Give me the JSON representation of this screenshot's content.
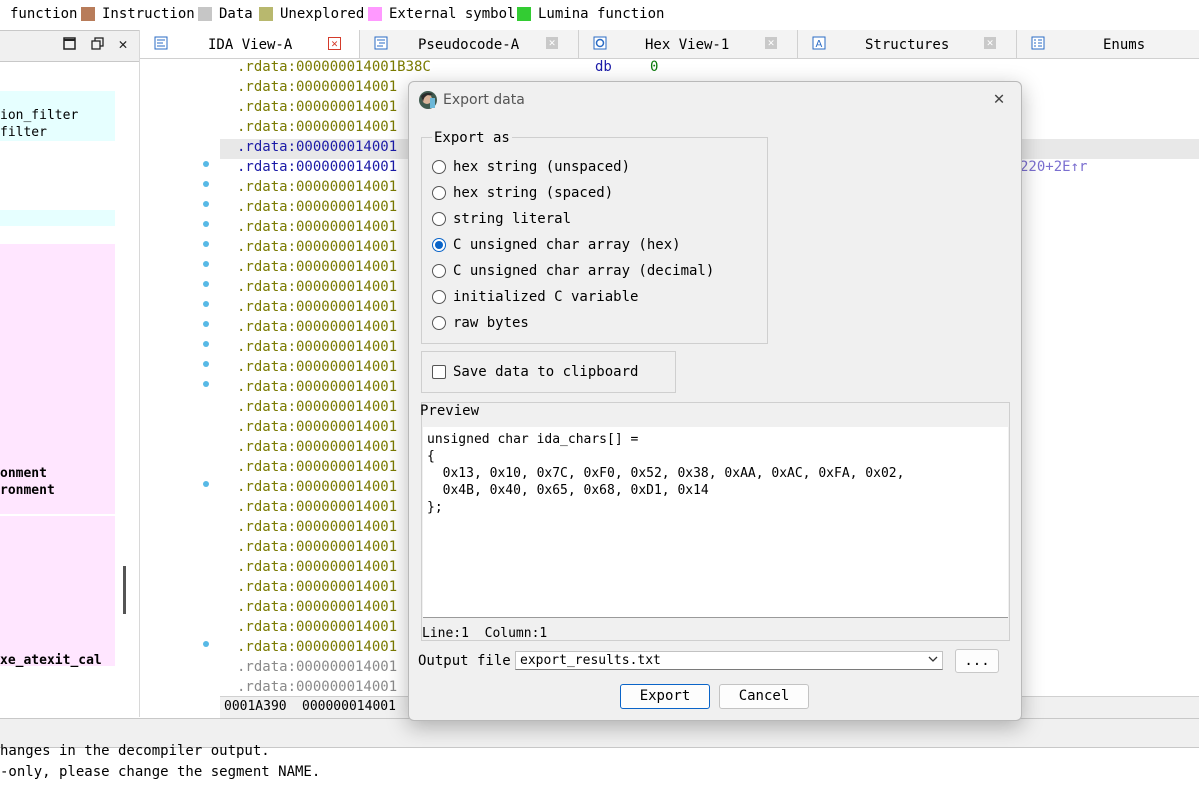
{
  "legend": [
    {
      "label": "function",
      "color": ""
    },
    {
      "label": "Instruction",
      "color": "#b87c5a"
    },
    {
      "label": "Data",
      "color": "#c6c6c6"
    },
    {
      "label": "Unexplored",
      "color": "#b8b86e"
    },
    {
      "label": "External symbol",
      "color": "#ff99ff"
    },
    {
      "label": "Lumina function",
      "color": "#33cc33"
    }
  ],
  "left_panel": {
    "lines": [
      "ion_filter",
      "filter",
      "onment",
      "ronment",
      "xe_atexit_cal"
    ]
  },
  "tabs": [
    {
      "label": "IDA View-A",
      "icon": "ida-view-icon",
      "active": true
    },
    {
      "label": "Pseudocode-A",
      "icon": "pseudocode-icon",
      "active": false
    },
    {
      "label": "Hex View-1",
      "icon": "hex-view-icon",
      "active": false
    },
    {
      "label": "Structures",
      "icon": "structures-icon",
      "active": false
    },
    {
      "label": "Enums",
      "icon": "enums-icon",
      "active": false
    }
  ],
  "ida_view": {
    "first_line": ".rdata:000000014001B38C",
    "first_mnemonic": "db",
    "first_operand": "0",
    "line_prefix": ".rdata:000000014001",
    "xref_fragment": "220+2E↑r",
    "status_offset": "0001A390",
    "status_address": "000000014001"
  },
  "output": {
    "lines": [
      "hanges in the decompiler output.",
      "-only, please change the segment NAME."
    ]
  },
  "dialog": {
    "title": "Export data",
    "export_as": {
      "title": "Export as",
      "options": [
        {
          "label": "hex string (unspaced)",
          "checked": false
        },
        {
          "label": "hex string (spaced)",
          "checked": false
        },
        {
          "label": "string literal",
          "checked": false
        },
        {
          "label": "C unsigned char array (hex)",
          "checked": true
        },
        {
          "label": "C unsigned char array (decimal)",
          "checked": false
        },
        {
          "label": "initialized C variable",
          "checked": false
        },
        {
          "label": "raw bytes",
          "checked": false
        }
      ]
    },
    "clipboard_label": "Save data to clipboard",
    "clipboard_checked": false,
    "preview": {
      "title": "Preview",
      "lines": [
        "unsigned char ida_chars[] =",
        "{",
        "  0x13, 0x10, 0x7C, 0xF0, 0x52, 0x38, 0xAA, 0xAC, 0xFA, 0x02,",
        "  0x4B, 0x40, 0x65, 0x68, 0xD1, 0x14",
        "};"
      ],
      "status": "Line:1  Column:1"
    },
    "output_file_label": "Output file",
    "output_file_value": "export_results.txt",
    "browse_label": "...",
    "export_label": "Export",
    "cancel_label": "Cancel"
  }
}
